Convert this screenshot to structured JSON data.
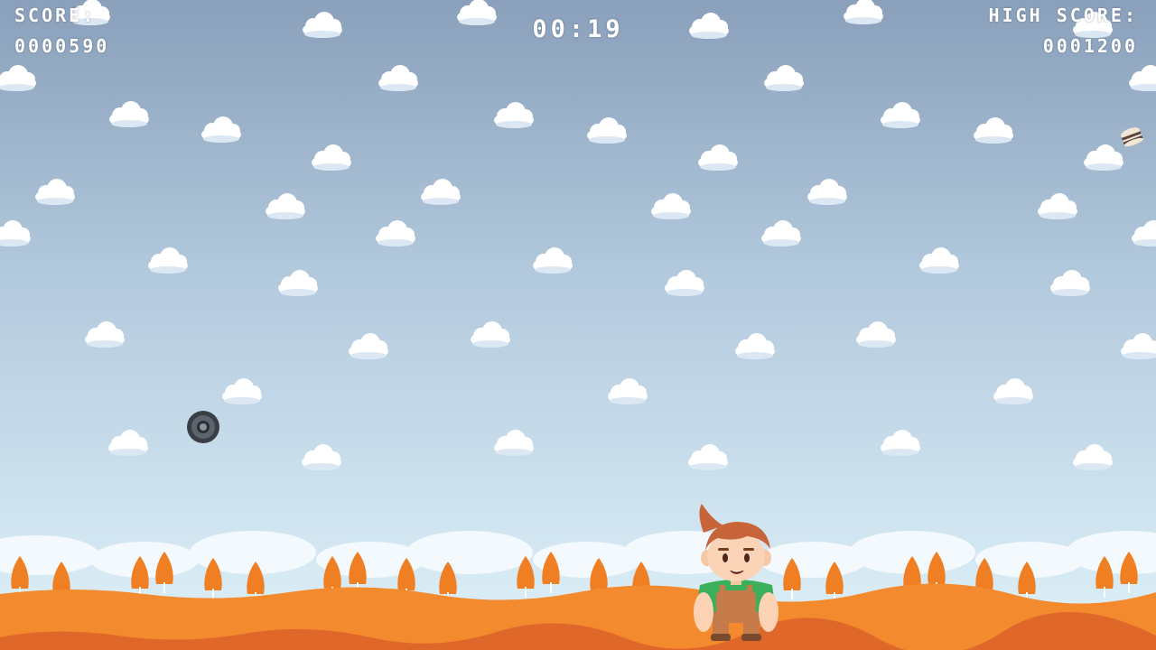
{
  "hud": {
    "score_label": "SCORE:",
    "score_value": "0000590",
    "timer": "00:19",
    "high_score_label": "HIGH SCORE:",
    "high_score_value": "0001200"
  },
  "colors": {
    "sky_top": "#8aa0bb",
    "sky_bottom": "#d9eef8",
    "ground": "#f48a2e",
    "ground_dark": "#e0672a",
    "shirt": "#3bb25a",
    "hair": "#c7643a"
  },
  "objects": {
    "falling_items": [
      "tire-icon",
      "burger-icon"
    ],
    "player": "boy-character"
  }
}
